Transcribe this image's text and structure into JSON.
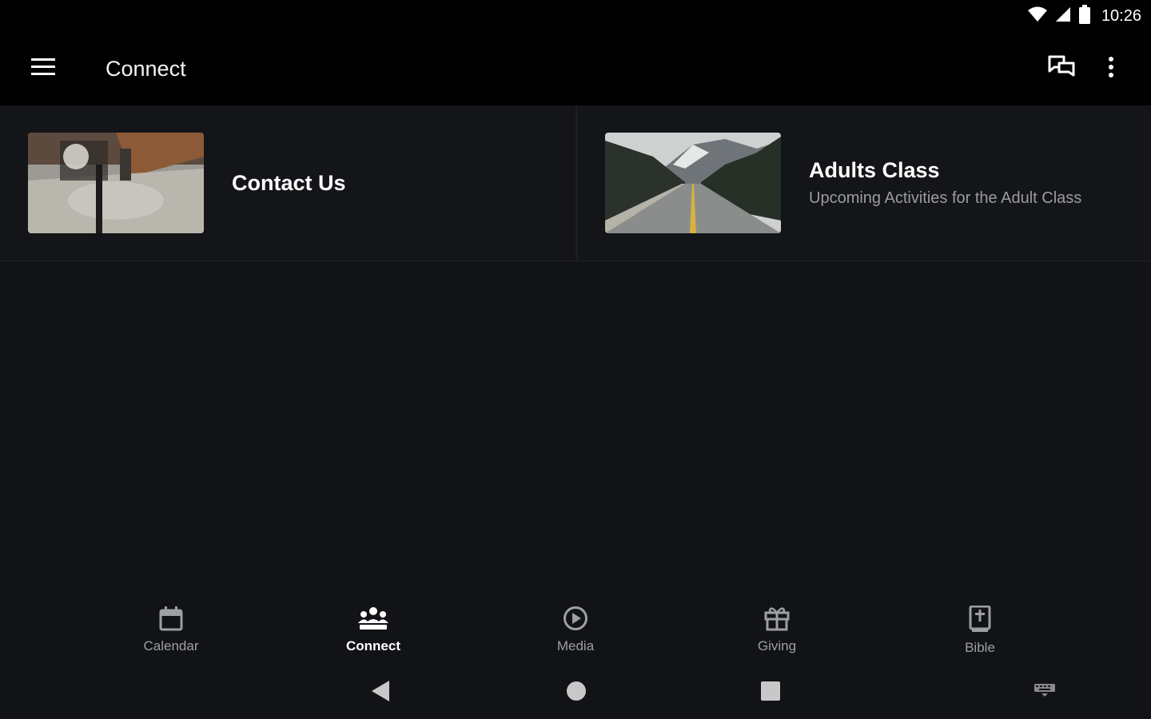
{
  "status_bar": {
    "time": "10:26",
    "icons": [
      "wifi-icon",
      "cellular-signal-icon",
      "battery-icon"
    ]
  },
  "app_bar": {
    "title": "Connect",
    "menu_icon": "hamburger-menu-icon",
    "actions": [
      "chat-icon",
      "more-vert-icon"
    ]
  },
  "cards": [
    {
      "title": "Contact Us",
      "subtitle": "",
      "image": "living-room-photo"
    },
    {
      "title": "Adults Class",
      "subtitle": "Upcoming Activities for the Adult Class",
      "image": "mountain-road-photo"
    }
  ],
  "bottom_nav": {
    "items": [
      {
        "label": "Calendar",
        "icon": "calendar-icon",
        "active": false
      },
      {
        "label": "Connect",
        "icon": "people-icon",
        "active": true
      },
      {
        "label": "Media",
        "icon": "play-circle-icon",
        "active": false
      },
      {
        "label": "Giving",
        "icon": "gift-icon",
        "active": false
      },
      {
        "label": "Bible",
        "icon": "bible-icon",
        "active": false
      }
    ]
  },
  "system_nav": [
    "back-icon",
    "home-icon",
    "recents-icon",
    "keyboard-icon"
  ],
  "colors": {
    "background": "#121316",
    "bars": "#000000",
    "inactive_text": "#9d9fa3",
    "active_text": "#ffffff"
  }
}
